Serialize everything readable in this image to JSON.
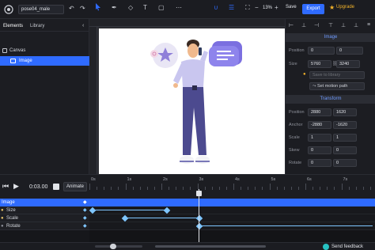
{
  "header": {
    "filename": "pose04_male",
    "zoom": "13%",
    "save_label": "Save",
    "export_label": "Export",
    "upgrade_label": "Upgrade"
  },
  "left_panel": {
    "tabs": [
      "Elements",
      "Library"
    ],
    "tree": [
      {
        "label": "Canvas",
        "selected": false
      },
      {
        "label": "Image",
        "selected": true
      }
    ]
  },
  "right_panel": {
    "image_section": "Image",
    "position_label": "Position",
    "position": [
      "0",
      "0"
    ],
    "size_label": "Size",
    "size": [
      "5760",
      "3240"
    ],
    "save_to_library": "Save to library",
    "set_motion_path": "Set motion path",
    "transform_section": "Transform",
    "t_position_label": "Position",
    "t_position": [
      "2880",
      "1620"
    ],
    "anchor_label": "Anchor",
    "anchor": [
      "-2880",
      "-1620"
    ],
    "scale_label": "Scale",
    "scale": [
      "1",
      "1"
    ],
    "skew_label": "Skew",
    "skew": [
      "0",
      "0"
    ],
    "rotate_label": "Rotate",
    "rotate": [
      "0",
      "0"
    ]
  },
  "timeline": {
    "time": "0:03.00",
    "animate_label": "Animate",
    "ticks": [
      "0s",
      "1s",
      "2s",
      "3s",
      "4s",
      "5s",
      "6s",
      "7s"
    ],
    "track_group": "Image",
    "tracks": [
      "Size",
      "Scale",
      "Rotate"
    ]
  },
  "footer": {
    "feedback_label": "Send feedback"
  },
  "colors": {
    "accent": "#2f6bff",
    "keyframe": "#7fc6ff",
    "upgrade": "#f3b32a"
  }
}
